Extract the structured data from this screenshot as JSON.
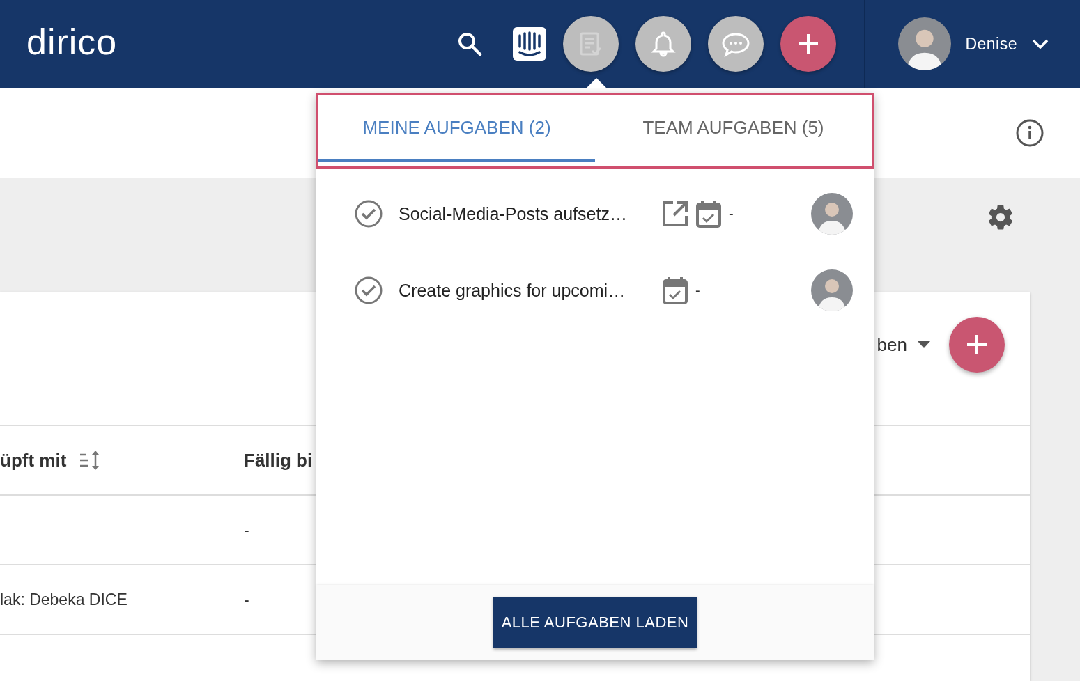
{
  "header": {
    "logo": "dirico",
    "user": {
      "name": "Denise"
    }
  },
  "page": {
    "card": {
      "dropdown_label": "ben"
    },
    "table": {
      "columns": [
        "üpft mit",
        "Fällig bi"
      ],
      "rows": [
        [
          "",
          "-"
        ],
        [
          "lak: Debeka DICE",
          "-"
        ]
      ]
    }
  },
  "tasks_popover": {
    "tabs": [
      {
        "label": "MEINE AUFGABEN (2)",
        "selected": true
      },
      {
        "label": "TEAM AUFGABEN (5)",
        "selected": false
      }
    ],
    "tasks": [
      {
        "title": "Social-Media-Posts aufsetz…",
        "has_link": true,
        "due": "-"
      },
      {
        "title": "Create graphics for upcomi…",
        "has_link": false,
        "due": "-"
      }
    ],
    "button": "ALLE AUFGABEN LADEN"
  }
}
